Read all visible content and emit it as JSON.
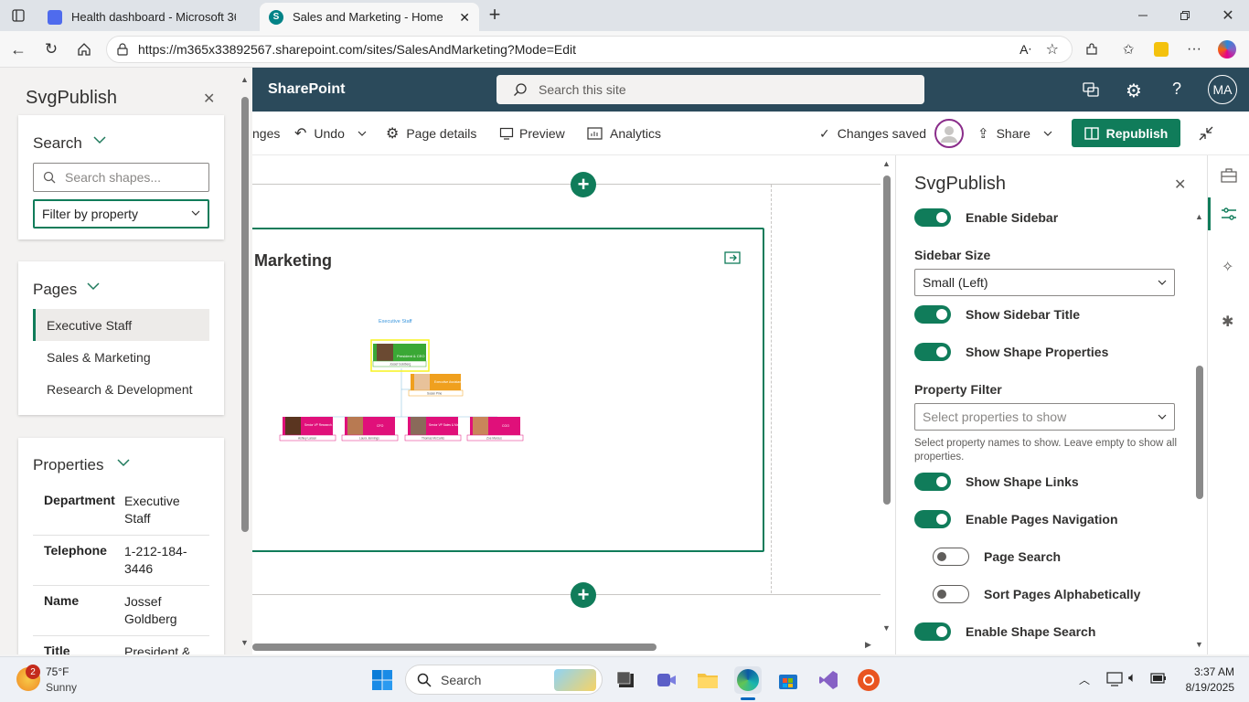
{
  "browser": {
    "tabs": [
      {
        "label": "Health dashboard - Microsoft 365",
        "active": false
      },
      {
        "label": "Sales and Marketing - Home",
        "active": true
      }
    ],
    "url": "https://m365x33892567.sharepoint.com/sites/SalesAndMarketing?Mode=Edit",
    "profile_initials": "MA"
  },
  "left_sidebar": {
    "title": "SvgPublish",
    "search": {
      "heading": "Search",
      "placeholder": "Search shapes...",
      "filter_label": "Filter by property"
    },
    "pages": {
      "heading": "Pages",
      "items": [
        {
          "label": "Executive Staff",
          "selected": true
        },
        {
          "label": "Sales & Marketing",
          "selected": false
        },
        {
          "label": "Research & Development",
          "selected": false
        }
      ]
    },
    "properties": {
      "heading": "Properties",
      "rows": [
        {
          "key": "Department",
          "value": "Executive Staff"
        },
        {
          "key": "Telephone",
          "value": "1-212-184-3446"
        },
        {
          "key": "Name",
          "value": "Jossef Goldberg"
        },
        {
          "key": "Title",
          "value": "President &"
        }
      ]
    }
  },
  "sharepoint": {
    "brand": "SharePoint",
    "search_placeholder": "Search this site",
    "commands": {
      "changes": "nges",
      "undo": "Undo",
      "page_details": "Page details",
      "preview": "Preview",
      "analytics": "Analytics",
      "status": "Changes saved",
      "share": "Share",
      "republish": "Republish"
    }
  },
  "canvas": {
    "webpart_title": "Marketing",
    "org_chart": {
      "title": "Executive Staff",
      "top": {
        "title": "President & CEO",
        "name": "Jossef Goldberg",
        "color": "#3aa835"
      },
      "assistant": {
        "title": "Executive Assistant",
        "name": "Susan Pine",
        "color": "#f0a01e"
      },
      "reports": [
        {
          "title": "Senior VP Research & Development",
          "name": "Ashley Larsen",
          "color": "#e0107a"
        },
        {
          "title": "CFO",
          "name": "Laura Jennings",
          "color": "#e0107a"
        },
        {
          "title": "Senior VP Sales & Marketing",
          "name": "Thomas McCants",
          "color": "#e0107a"
        },
        {
          "title": "COO",
          "name": "Zoe Marcus",
          "color": "#e0107a"
        }
      ]
    }
  },
  "right_pane": {
    "title": "SvgPublish",
    "items": [
      {
        "type": "toggle",
        "label": "Enable Sidebar",
        "on": true
      },
      {
        "type": "dropdown",
        "label": "Sidebar Size",
        "value": "Small (Left)"
      },
      {
        "type": "toggle",
        "label": "Show Sidebar Title",
        "on": true
      },
      {
        "type": "toggle",
        "label": "Show Shape Properties",
        "on": true
      },
      {
        "type": "dropdown",
        "label": "Property Filter",
        "placeholder": "Select properties to show",
        "help": "Select property names to show. Leave empty to show all properties."
      },
      {
        "type": "toggle",
        "label": "Show Shape Links",
        "on": true
      },
      {
        "type": "toggle",
        "label": "Enable Pages Navigation",
        "on": true
      },
      {
        "type": "toggle",
        "label": "Page Search",
        "on": false
      },
      {
        "type": "toggle",
        "label": "Sort Pages Alphabetically",
        "on": false
      },
      {
        "type": "toggle",
        "label": "Enable Shape Search",
        "on": true
      }
    ]
  },
  "taskbar": {
    "weather": {
      "temp": "75°F",
      "condition": "Sunny",
      "badge": "2"
    },
    "search_label": "Search",
    "time": "3:37 AM",
    "date": "8/19/2025"
  },
  "colors": {
    "accent_green": "#107c5a",
    "header_bg": "#2b4a5b",
    "republish_bg": "#107c5a"
  }
}
